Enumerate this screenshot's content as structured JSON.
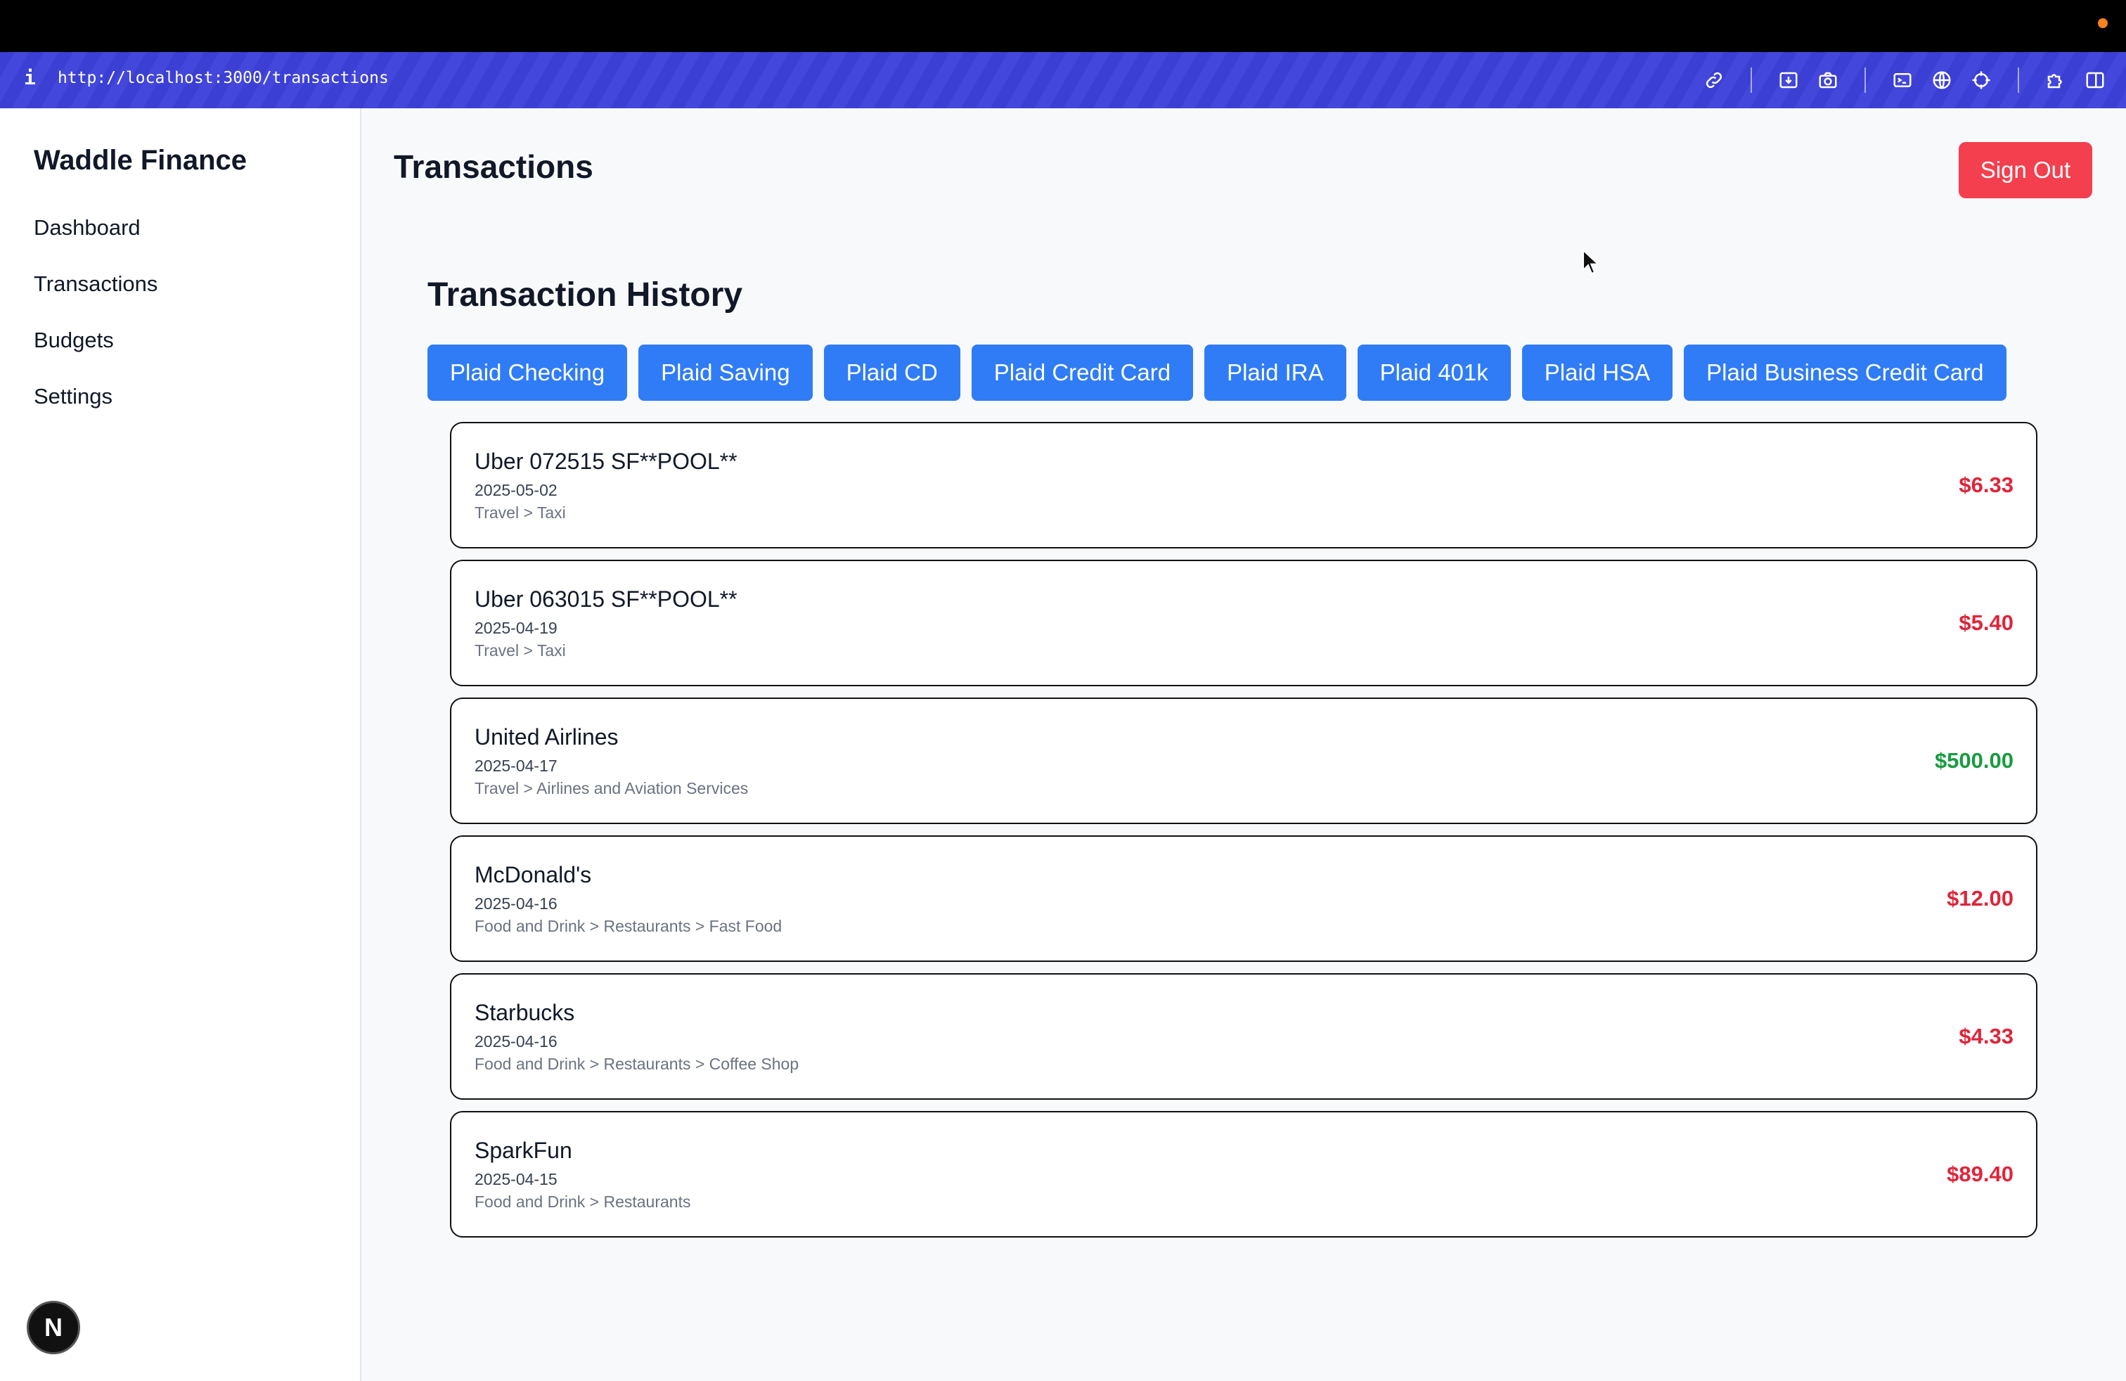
{
  "browser": {
    "info_glyph": "i",
    "url": "http://localhost:3000/transactions",
    "tool_icons": [
      "link-icon",
      "download-box-icon",
      "camera-icon",
      "terminal-icon",
      "globe-icon",
      "crosshair-icon",
      "puzzle-icon",
      "split-view-icon"
    ]
  },
  "sidebar": {
    "brand": "Waddle Finance",
    "items": [
      {
        "label": "Dashboard"
      },
      {
        "label": "Transactions"
      },
      {
        "label": "Budgets"
      },
      {
        "label": "Settings"
      }
    ]
  },
  "header": {
    "title": "Transactions",
    "sign_out": "Sign Out"
  },
  "section_title": "Transaction History",
  "accounts": [
    {
      "label": "Plaid Checking"
    },
    {
      "label": "Plaid Saving"
    },
    {
      "label": "Plaid CD"
    },
    {
      "label": "Plaid Credit Card"
    },
    {
      "label": "Plaid IRA"
    },
    {
      "label": "Plaid 401k"
    },
    {
      "label": "Plaid HSA"
    },
    {
      "label": "Plaid Business Credit Card"
    }
  ],
  "transactions": [
    {
      "name": "Uber 072515 SF**POOL**",
      "date": "2025-05-02",
      "category": "Travel > Taxi",
      "amount": "$6.33",
      "kind": "neg"
    },
    {
      "name": "Uber 063015 SF**POOL**",
      "date": "2025-04-19",
      "category": "Travel > Taxi",
      "amount": "$5.40",
      "kind": "neg"
    },
    {
      "name": "United Airlines",
      "date": "2025-04-17",
      "category": "Travel > Airlines and Aviation Services",
      "amount": "$500.00",
      "kind": "pos"
    },
    {
      "name": "McDonald's",
      "date": "2025-04-16",
      "category": "Food and Drink > Restaurants > Fast Food",
      "amount": "$12.00",
      "kind": "neg"
    },
    {
      "name": "Starbucks",
      "date": "2025-04-16",
      "category": "Food and Drink > Restaurants > Coffee Shop",
      "amount": "$4.33",
      "kind": "neg"
    },
    {
      "name": "SparkFun",
      "date": "2025-04-15",
      "category": "Food and Drink > Restaurants",
      "amount": "$89.40",
      "kind": "neg"
    }
  ],
  "colors": {
    "negative": "#e0243a",
    "positive": "#179c3f",
    "accent": "#2f7cf6",
    "danger": "#f43f4e"
  },
  "dev_badge": "N"
}
